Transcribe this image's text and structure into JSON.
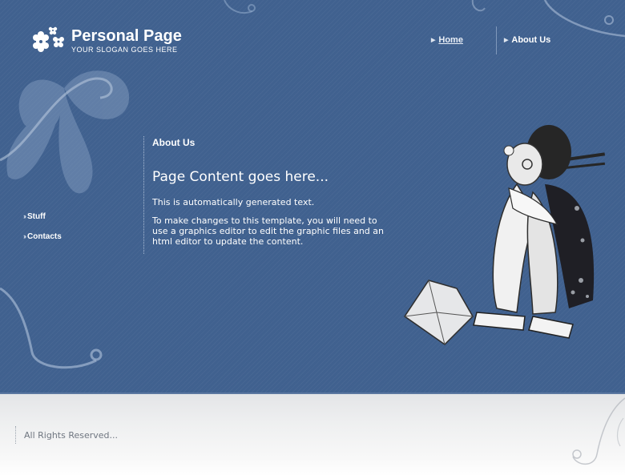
{
  "header": {
    "logo_title": "Personal Page",
    "logo_slogan": "YOUR SLOGAN GOES HERE",
    "logo_icon": "flower-icon"
  },
  "nav": {
    "items": [
      {
        "label": "Home",
        "active": true
      },
      {
        "label": "About Us",
        "active": false
      }
    ],
    "arrow_icon": "triangle-right-icon"
  },
  "sidebar": {
    "links": [
      {
        "label": "Stuff"
      },
      {
        "label": "Contacts"
      }
    ],
    "bullet_icon": "double-chevron-icon"
  },
  "content": {
    "heading": "About Us",
    "title": "Page Content goes here...",
    "paragraphs": [
      "This is automatically generated text.",
      "To make changes to this template, you will need to use a graphics editor to edit the graphic files and an html editor to update the content."
    ]
  },
  "illustration": {
    "name": "geisha-figure-illustration"
  },
  "footer": {
    "text": "All Rights Reserved..."
  },
  "colors": {
    "main_background": "#40618f",
    "footer_background": "#eeeff0",
    "text_primary": "#ffffff",
    "footer_text": "#6f7680"
  }
}
